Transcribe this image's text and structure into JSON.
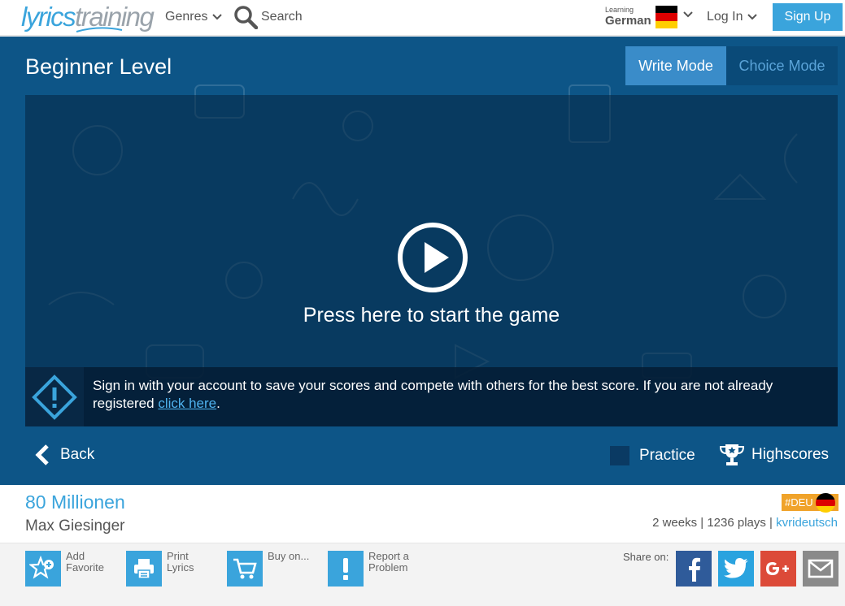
{
  "header": {
    "logo_part1": "lyrics",
    "logo_part2": "training",
    "genres_label": "Genres",
    "search_label": "Search",
    "learning_small": "Learning",
    "learning_language": "German",
    "login_label": "Log In",
    "signup_label": "Sign Up"
  },
  "game": {
    "level_title": "Beginner Level",
    "mode_write": "Write Mode",
    "mode_choice": "Choice Mode",
    "start_text": "Press here to start the game",
    "notice_text": "Sign in with your account to save your scores and compete with others for the best score. If you are not already registered ",
    "notice_link": "click here",
    "notice_end": ".",
    "back_label": "Back",
    "practice_label": "Practice",
    "highscores_label": "Highscores"
  },
  "song": {
    "title": "80 Millionen",
    "artist": "Max Giesinger",
    "tag": "#DEU",
    "meta_prefix": "2 weeks | 1236 plays | ",
    "uploader": "kvrideutsch"
  },
  "actions": {
    "add_favorite_1": "Add",
    "add_favorite_2": "Favorite",
    "print_lyrics_1": "Print",
    "print_lyrics_2": "Lyrics",
    "buy_on": "Buy on...",
    "report_1": "Report a",
    "report_2": "Problem",
    "share_label": "Share on:"
  },
  "colors": {
    "brand_blue": "#3aa4dc",
    "hero_bg": "#0d5587",
    "tag_orange": "#f0a32a",
    "facebook": "#2f5b9a",
    "twitter": "#2aa3df",
    "google_plus": "#dc4a38",
    "email": "#8a8a8a"
  },
  "icons": {
    "genres_chevron": "chevron-down-icon",
    "search": "magnifier-icon",
    "play": "play-circle-icon",
    "notice": "exclamation-diamond-icon",
    "back": "chevron-left-icon",
    "highscores": "trophy-icon",
    "favorite": "star-plus-icon",
    "print": "printer-icon",
    "buy": "cart-icon",
    "report": "exclamation-icon"
  }
}
